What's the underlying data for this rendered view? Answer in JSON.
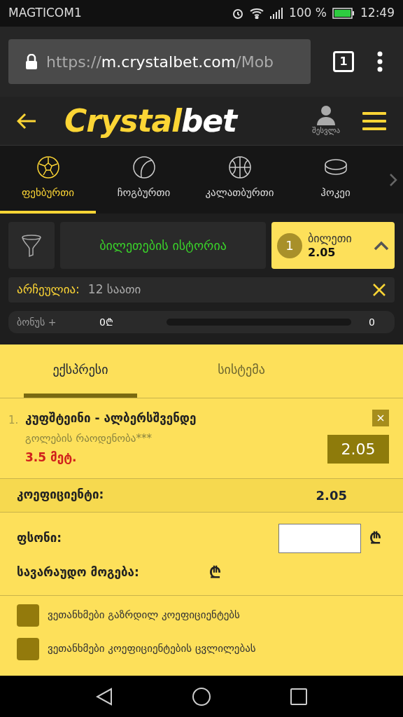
{
  "status_bar": {
    "carrier": "MAGTICOM1",
    "battery": "100 %",
    "time": "12:49"
  },
  "browser": {
    "url_scheme": "https://",
    "url_host": "m.crystalbet.com",
    "url_path": "/Mob",
    "tab_count": "1"
  },
  "header": {
    "logo_part1": "Crystal",
    "logo_part2": "bet",
    "login_label": "შესვლა"
  },
  "sports": [
    {
      "kind": "football",
      "label": "ფეხბურთი",
      "selected": true
    },
    {
      "kind": "tennis",
      "label": "ჩოგბურთი",
      "selected": false
    },
    {
      "kind": "basketball",
      "label": "კალათბურთი",
      "selected": false
    },
    {
      "kind": "hockey",
      "label": "ჰოკეი",
      "selected": false
    }
  ],
  "ticket_bar": {
    "history_button": "ბილეთების ისტორია",
    "ticket_count": "1",
    "ticket_label": "ბილეთი",
    "ticket_odds": "2.05",
    "expanded": true
  },
  "filter": {
    "label": "არჩეულია:",
    "value": "12 საათი"
  },
  "bonus": {
    "label": "ბონუს +",
    "amount": "0₾",
    "level": 0,
    "count": "0"
  },
  "bet_tabs": [
    {
      "label": "ექსპრესი",
      "selected": true
    },
    {
      "label": "სისტემა",
      "selected": false
    }
  ],
  "selections": [
    {
      "number": "1.",
      "match": "კუფშტეინი - ალბერსშვენდე",
      "market": "გოლების რაოდენობა***",
      "pick": "3.5 მეტ.",
      "odds": "2.05"
    }
  ],
  "coefficient": {
    "label": "კოეფიციენტი:",
    "value": "2.05"
  },
  "stake": {
    "label": "ფსონი:",
    "currency": "₾"
  },
  "possible_win": {
    "label": "სავარაუდო მოგება:",
    "currency": "₾"
  },
  "agreements": [
    {
      "label": "ვეთანხმები გაზრდილ კოეფიციენტებს",
      "checked": false
    },
    {
      "label": "ვეთანხმები კოეფიციენტების ცვლილებას",
      "checked": false
    }
  ]
}
